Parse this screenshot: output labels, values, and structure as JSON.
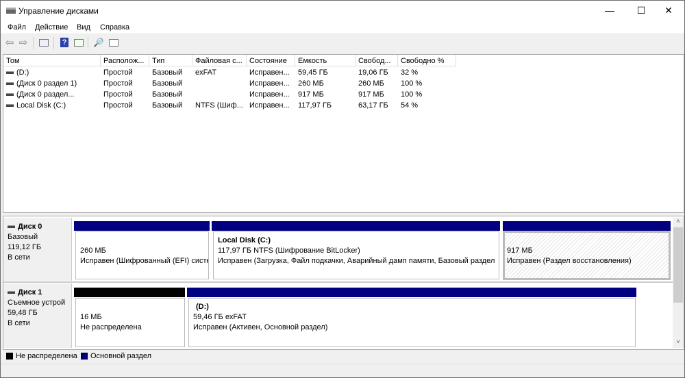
{
  "window": {
    "title": "Управление дисками",
    "minimize": "—",
    "maximize": "☐",
    "close": "✕"
  },
  "menu": [
    "Файл",
    "Действие",
    "Вид",
    "Справка"
  ],
  "toolbar": [
    "back-icon",
    "forward-icon",
    "console-tree-icon",
    "help-icon",
    "action-pane-icon",
    "rescan-icon",
    "properties-icon"
  ],
  "columns": [
    "Том",
    "Располож...",
    "Тип",
    "Файловая с...",
    "Состояние",
    "Емкость",
    "Свобод...",
    "Свободно %"
  ],
  "volumes": [
    [
      "(D:)",
      "Простой",
      "Базовый",
      "exFAT",
      "Исправен...",
      "59,45 ГБ",
      "19,06 ГБ",
      "32 %"
    ],
    [
      "(Диск 0 раздел 1)",
      "Простой",
      "Базовый",
      "",
      "Исправен...",
      "260 МБ",
      "260 МБ",
      "100 %"
    ],
    [
      "(Диск 0 раздел...",
      "Простой",
      "Базовый",
      "",
      "Исправен...",
      "917 МБ",
      "917 МБ",
      "100 %"
    ],
    [
      "Local Disk (C:)",
      "Простой",
      "Базовый",
      "NTFS (Шиф...",
      "Исправен...",
      "117,97 ГБ",
      "63,17 ГБ",
      "54 %"
    ]
  ],
  "disks": [
    {
      "name": "Диск 0",
      "type": "Базовый",
      "size": "119,12 ГБ",
      "status": "В сети",
      "partitions": [
        {
          "title": "",
          "size": "260 МБ",
          "status": "Исправен (Шифрованный (EFI) систе"
        },
        {
          "title": "Local Disk  (C:)",
          "size": "117,97 ГБ NTFS (Шифрование BitLocker)",
          "status": "Исправен (Загрузка, Файл подкачки, Аварийный дамп памяти, Базовый раздел"
        },
        {
          "title": "",
          "size": "917 МБ",
          "status": "Исправен (Раздел восстановления)"
        }
      ]
    },
    {
      "name": "Диск 1",
      "type": "Съемное устрой",
      "size": "59,48 ГБ",
      "status": "В сети",
      "partitions": [
        {
          "title": "",
          "size": "16 МБ",
          "status": "Не распределена"
        },
        {
          "title": "(D:)",
          "size": "59,46 ГБ exFAT",
          "status": "Исправен (Активен, Основной раздел)"
        }
      ]
    }
  ],
  "legend": [
    {
      "label": "Не распределена",
      "color": "#000000"
    },
    {
      "label": "Основной раздел",
      "color": "#000080"
    }
  ],
  "colors": {
    "primary": "#000080",
    "unallocated": "#000000"
  }
}
